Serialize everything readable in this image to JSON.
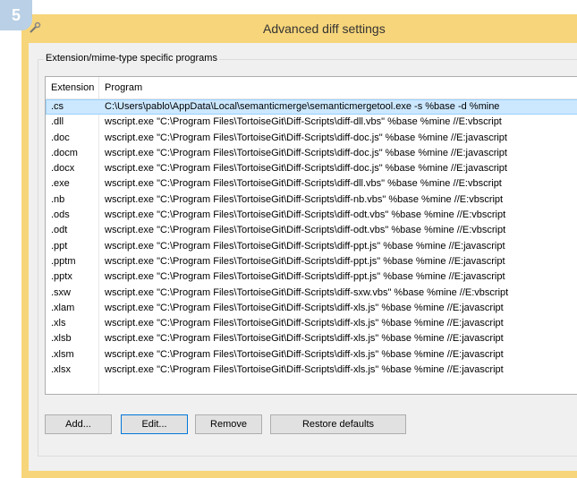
{
  "step_badge": "5",
  "window": {
    "title": "Advanced diff settings",
    "icon": "tool-icon"
  },
  "group": {
    "label": "Extension/mime-type specific programs"
  },
  "list": {
    "columns": [
      "Extension",
      "Program"
    ],
    "rows": [
      {
        "ext": ".cs",
        "program": "C:\\Users\\pablo\\AppData\\Local\\semanticmerge\\semanticmergetool.exe -s %base -d %mine",
        "selected": true
      },
      {
        "ext": ".dll",
        "program": "wscript.exe \"C:\\Program Files\\TortoiseGit\\Diff-Scripts\\diff-dll.vbs\" %base %mine //E:vbscript"
      },
      {
        "ext": ".doc",
        "program": "wscript.exe \"C:\\Program Files\\TortoiseGit\\Diff-Scripts\\diff-doc.js\" %base %mine //E:javascript"
      },
      {
        "ext": ".docm",
        "program": "wscript.exe \"C:\\Program Files\\TortoiseGit\\Diff-Scripts\\diff-doc.js\" %base %mine //E:javascript"
      },
      {
        "ext": ".docx",
        "program": "wscript.exe \"C:\\Program Files\\TortoiseGit\\Diff-Scripts\\diff-doc.js\" %base %mine //E:javascript"
      },
      {
        "ext": ".exe",
        "program": "wscript.exe \"C:\\Program Files\\TortoiseGit\\Diff-Scripts\\diff-dll.vbs\" %base %mine //E:vbscript"
      },
      {
        "ext": ".nb",
        "program": "wscript.exe \"C:\\Program Files\\TortoiseGit\\Diff-Scripts\\diff-nb.vbs\" %base %mine //E:vbscript"
      },
      {
        "ext": ".ods",
        "program": "wscript.exe \"C:\\Program Files\\TortoiseGit\\Diff-Scripts\\diff-odt.vbs\" %base %mine //E:vbscript"
      },
      {
        "ext": ".odt",
        "program": "wscript.exe \"C:\\Program Files\\TortoiseGit\\Diff-Scripts\\diff-odt.vbs\" %base %mine //E:vbscript"
      },
      {
        "ext": ".ppt",
        "program": "wscript.exe \"C:\\Program Files\\TortoiseGit\\Diff-Scripts\\diff-ppt.js\" %base %mine //E:javascript"
      },
      {
        "ext": ".pptm",
        "program": "wscript.exe \"C:\\Program Files\\TortoiseGit\\Diff-Scripts\\diff-ppt.js\" %base %mine //E:javascript"
      },
      {
        "ext": ".pptx",
        "program": "wscript.exe \"C:\\Program Files\\TortoiseGit\\Diff-Scripts\\diff-ppt.js\" %base %mine //E:javascript"
      },
      {
        "ext": ".sxw",
        "program": "wscript.exe \"C:\\Program Files\\TortoiseGit\\Diff-Scripts\\diff-sxw.vbs\" %base %mine //E:vbscript"
      },
      {
        "ext": ".xlam",
        "program": "wscript.exe \"C:\\Program Files\\TortoiseGit\\Diff-Scripts\\diff-xls.js\" %base %mine //E:javascript"
      },
      {
        "ext": ".xls",
        "program": "wscript.exe \"C:\\Program Files\\TortoiseGit\\Diff-Scripts\\diff-xls.js\" %base %mine //E:javascript"
      },
      {
        "ext": ".xlsb",
        "program": "wscript.exe \"C:\\Program Files\\TortoiseGit\\Diff-Scripts\\diff-xls.js\" %base %mine //E:javascript"
      },
      {
        "ext": ".xlsm",
        "program": "wscript.exe \"C:\\Program Files\\TortoiseGit\\Diff-Scripts\\diff-xls.js\" %base %mine //E:javascript"
      },
      {
        "ext": ".xlsx",
        "program": "wscript.exe \"C:\\Program Files\\TortoiseGit\\Diff-Scripts\\diff-xls.js\" %base %mine //E:javascript"
      }
    ]
  },
  "buttons": {
    "add": "Add...",
    "edit": "Edit...",
    "remove": "Remove",
    "restore": "Restore defaults"
  },
  "colors": {
    "window_frame": "#f7d57a",
    "selection": "#cce8ff",
    "badge": "#b9d0e6"
  }
}
